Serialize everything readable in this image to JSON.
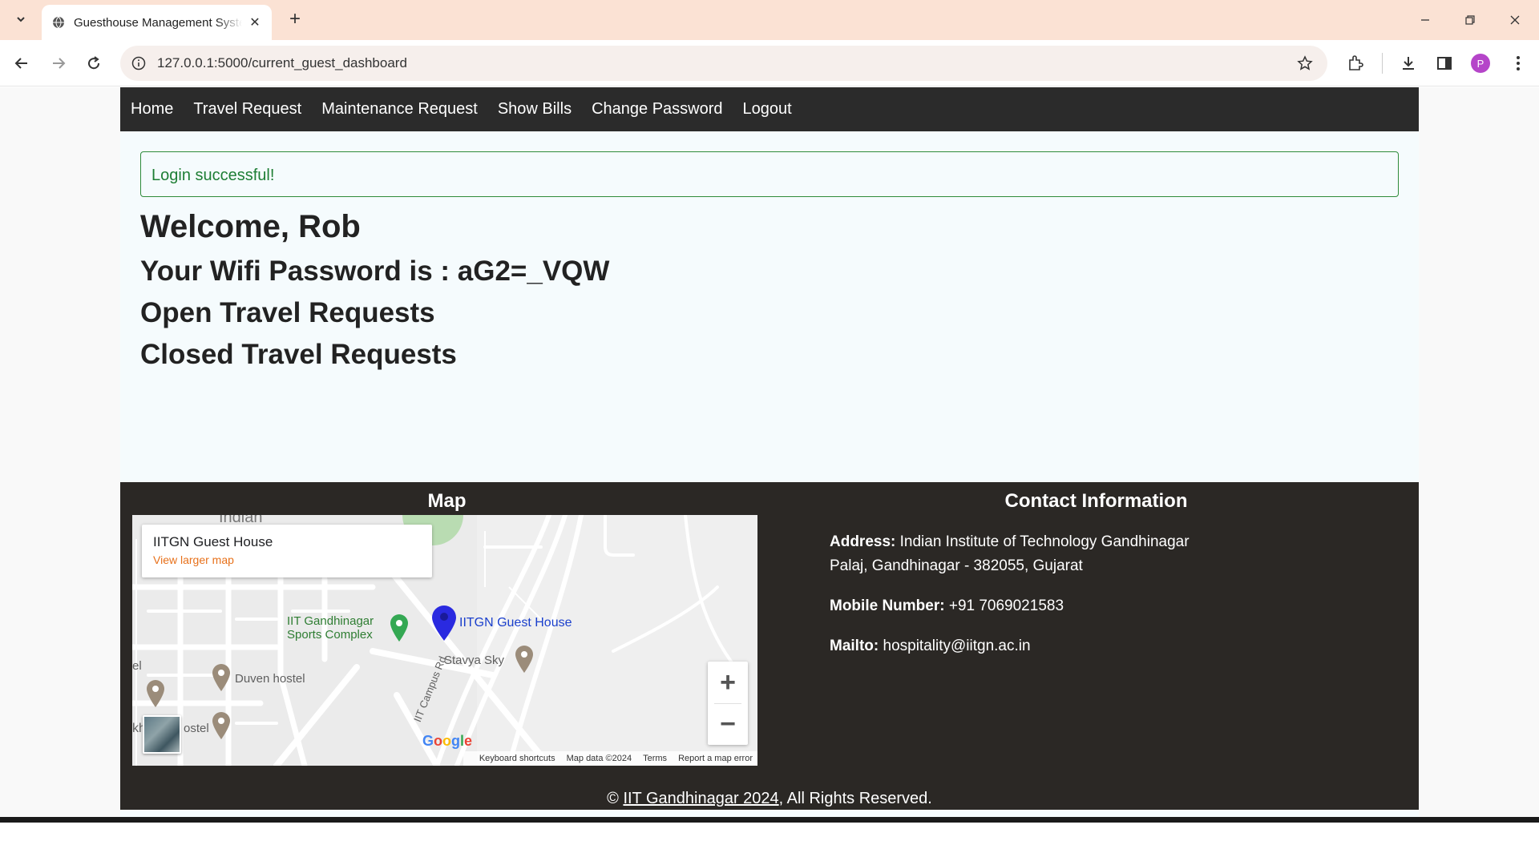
{
  "browser": {
    "tab_title": "Guesthouse Management System",
    "url": "127.0.0.1:5000/current_guest_dashboard",
    "profile_initial": "P"
  },
  "nav": {
    "items": [
      "Home",
      "Travel Request",
      "Maintenance Request",
      "Show Bills",
      "Change Password",
      "Logout"
    ]
  },
  "alert": {
    "message": "Login successful!"
  },
  "dashboard": {
    "welcome": "Welcome, Rob",
    "wifi": "Your Wifi Password is : aG2=_VQW",
    "open_requests": "Open Travel Requests",
    "closed_requests": "Closed Travel Requests"
  },
  "footer": {
    "map_title": "Map",
    "contact_title": "Contact Information",
    "address_label": "Address:",
    "address_line1": "Indian Institute of Technology Gandhinagar",
    "address_line2": "Palaj, Gandhinagar - 382055, Gujarat",
    "mobile_label": "Mobile Number:",
    "mobile": "+91 7069021583",
    "mail_label": "Mailto:",
    "mail": "hospitality@iitgn.ac.in",
    "copyright_symbol": "©",
    "copyright_link": "IIT Gandhinagar 2024",
    "copyright_rest": ", All Rights Reserved."
  },
  "map": {
    "card_title": "IITGN Guest House",
    "card_link": "View larger map",
    "label_indian": "Indian",
    "label_sports_1": "IIT Gandhinagar",
    "label_sports_2": "Sports Complex",
    "label_guesthouse": "IITGN Guest House",
    "label_stavya": "Stavya Sky",
    "label_duven": "Duven hostel",
    "label_hostel_left": "ostel",
    "label_el": "el",
    "label_kh": "kh",
    "label_road": "IIT Campus Rd",
    "zoom_in": "+",
    "zoom_out": "−",
    "footer_shortcuts": "Keyboard shortcuts",
    "footer_data": "Map data ©2024",
    "footer_terms": "Terms",
    "footer_report": "Report a map error",
    "google": "Google"
  },
  "colors": {
    "navbar": "#2b2b2b",
    "footer": "#2b2825",
    "alert_border": "#2e8b3a",
    "alert_text": "#1e7e34",
    "tabbar": "#fbe2d4"
  }
}
